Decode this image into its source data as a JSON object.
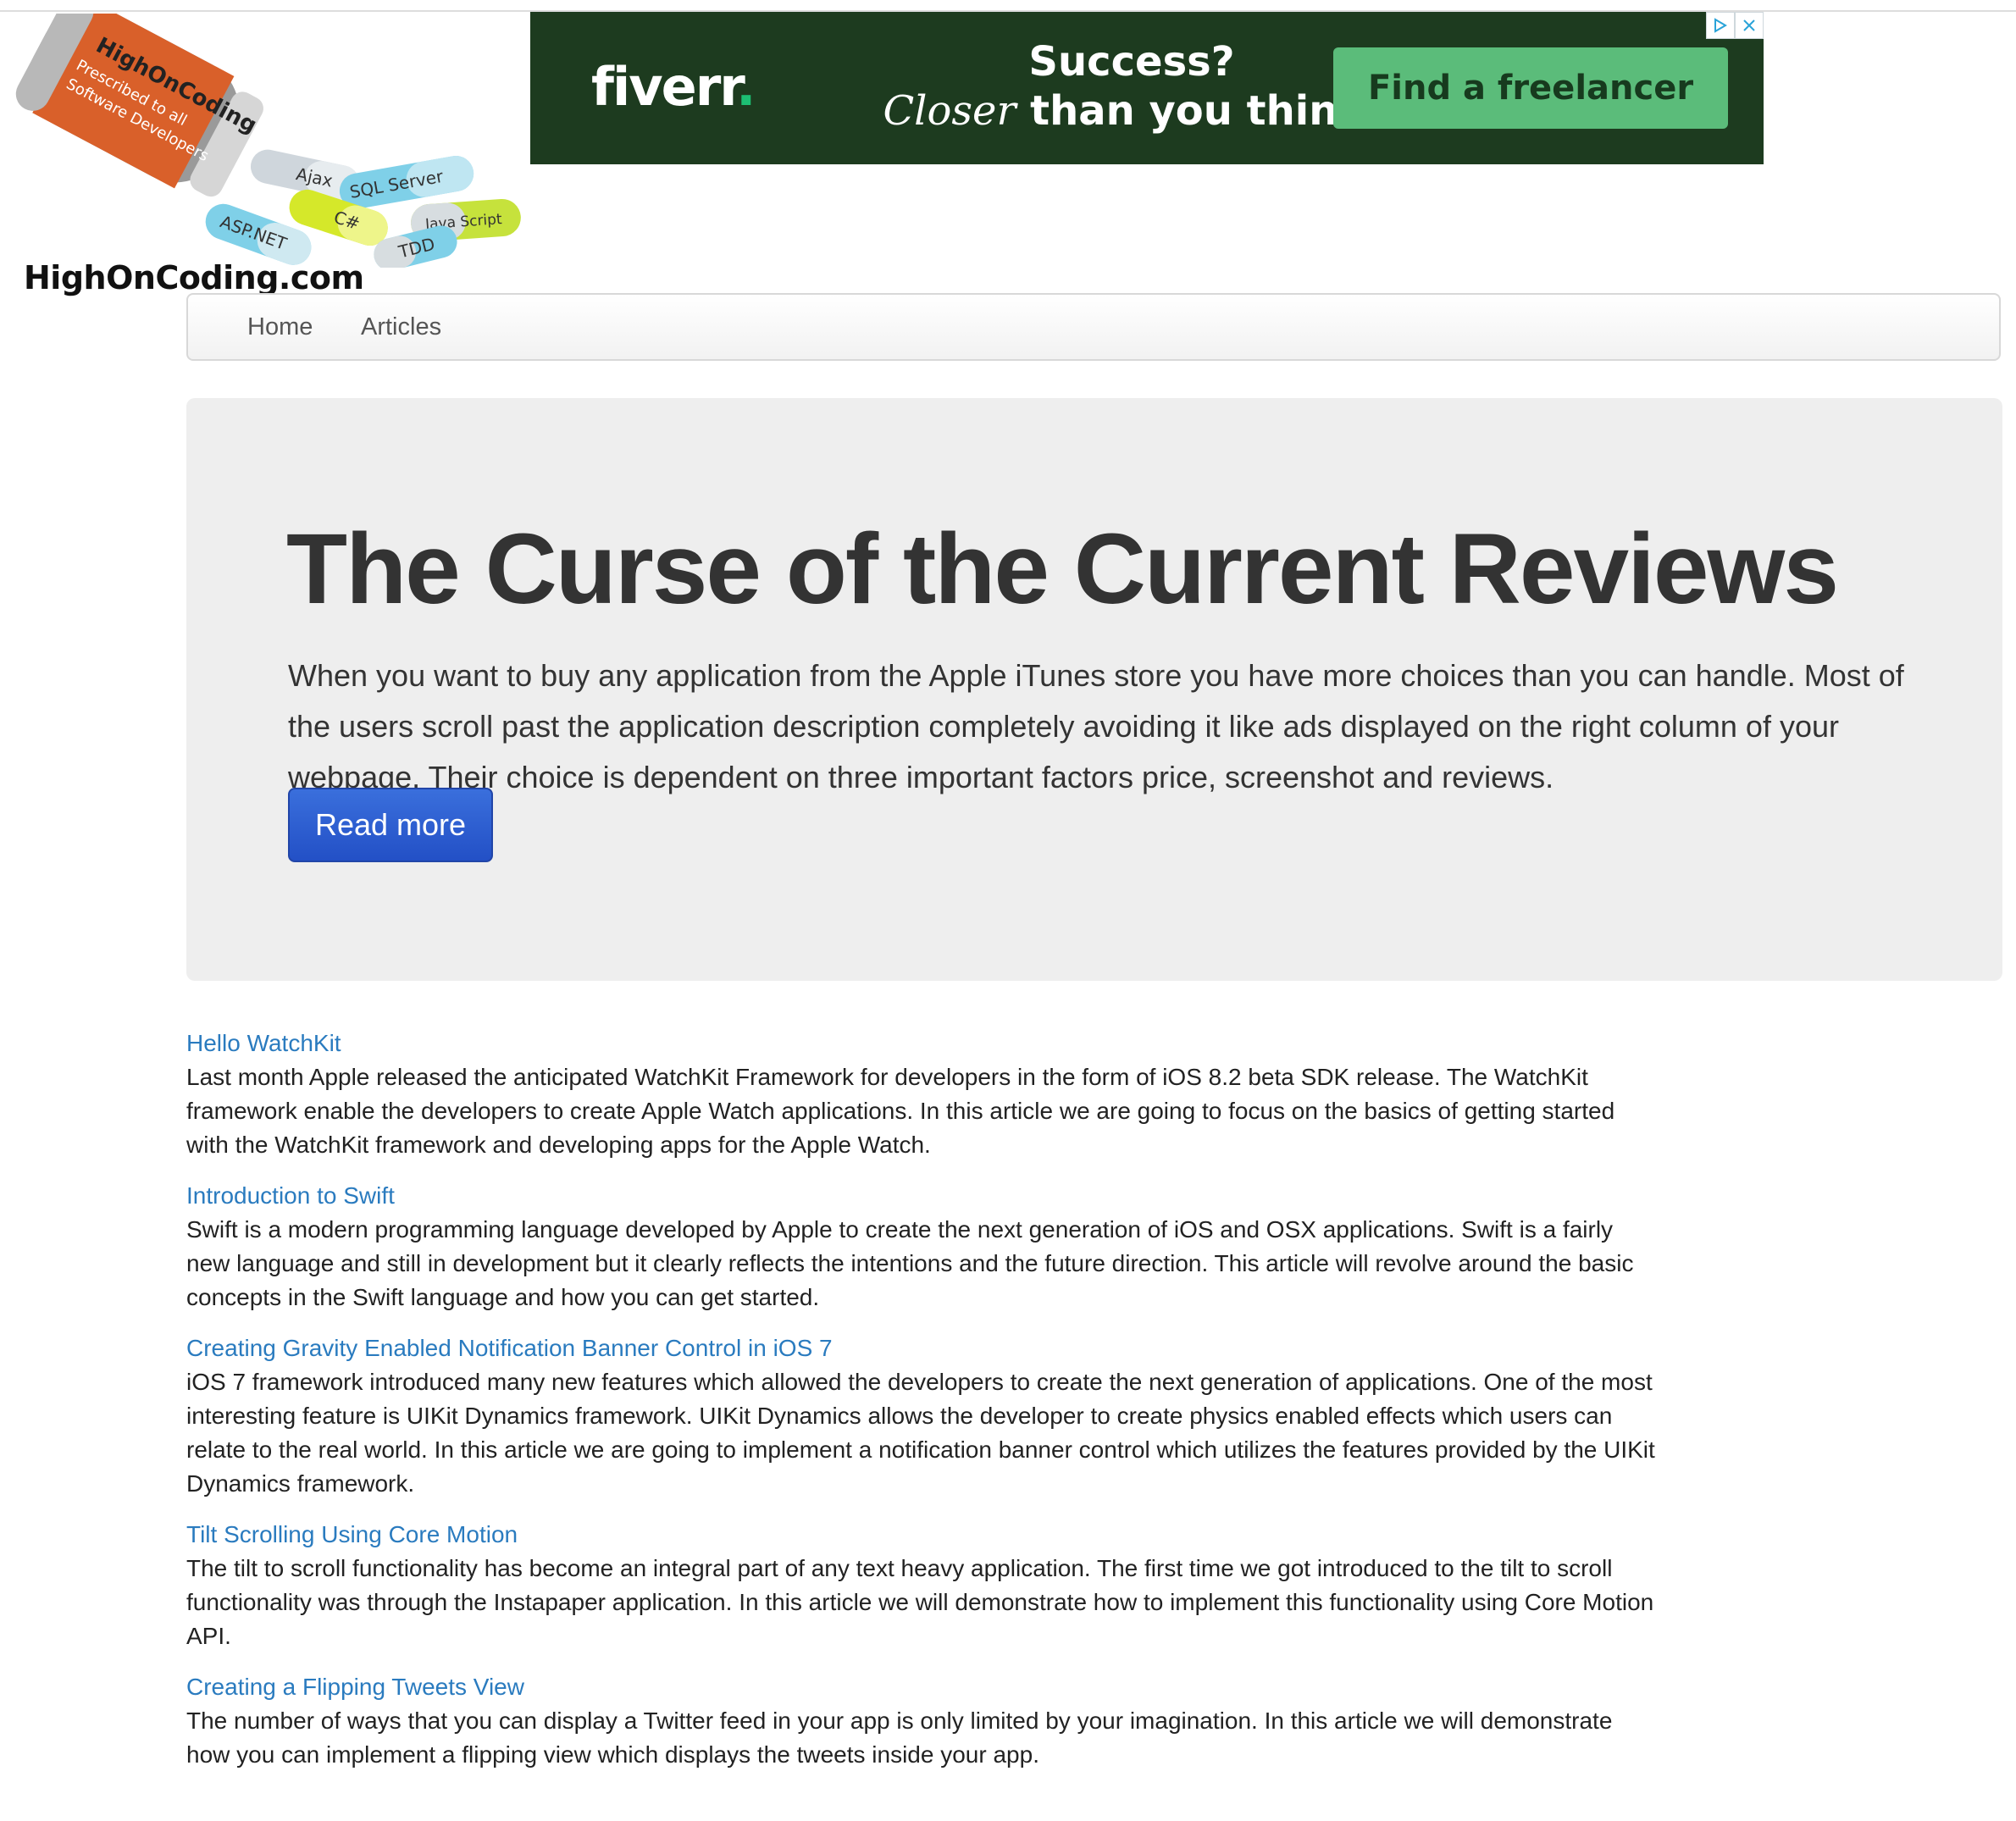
{
  "site": {
    "logo_text": "HighOnCoding.com",
    "logo_pill_labels": [
      "Ajax",
      "SQL Server",
      "C#",
      "Java Script",
      "ASP.NET",
      "TDD"
    ],
    "logo_bottle_text": "HighOnCoding Prescribed to all Software Developers"
  },
  "ad": {
    "brand": "fiverr",
    "brand_dot": ".",
    "headline_line1": "Success?",
    "headline_italic": "Closer",
    "headline_line2_rest": "than you think.",
    "cta_label": "Find a freelancer",
    "adchoices_icon": "adchoices-icon",
    "close_icon": "close-icon",
    "background_color": "#1d3b1f",
    "cta_color": "#5bbc7a"
  },
  "nav": {
    "items": [
      {
        "label": "Home"
      },
      {
        "label": "Articles"
      }
    ]
  },
  "jumbotron": {
    "title": "The Curse of the Current Reviews",
    "lead": "When you want to buy any application from the Apple iTunes store you have more choices than you can handle. Most of the users scroll past the application description completely avoiding it like ads displayed on the right column of your webpage. Their choice is dependent on three important factors price, screenshot and reviews.",
    "button_label": "Read more",
    "button_color": "#2a5bd7"
  },
  "articles": [
    {
      "title": "Hello WatchKit",
      "description": "Last month Apple released the anticipated WatchKit Framework for developers in the form of iOS 8.2 beta SDK release. The WatchKit framework enable the developers to create Apple Watch applications. In this article we are going to focus on the basics of getting started with the WatchKit framework and developing apps for the Apple Watch."
    },
    {
      "title": "Introduction to Swift",
      "description": "Swift is a modern programming language developed by Apple to create the next generation of iOS and OSX applications. Swift is a fairly new language and still in development but it clearly reflects the intentions and the future direction. This article will revolve around the basic concepts in the Swift language and how you can get started."
    },
    {
      "title": "Creating Gravity Enabled Notification Banner Control in iOS 7",
      "description": "iOS 7 framework introduced many new features which allowed the developers to create the next generation of applications. One of the most interesting feature is UIKit Dynamics framework. UIKit Dynamics allows the developer to create physics enabled effects which users can relate to the real world. In this article we are going to implement a notification banner control which utilizes the features provided by the UIKit Dynamics framework."
    },
    {
      "title": "Tilt Scrolling Using Core Motion",
      "description": "The tilt to scroll functionality has become an integral part of any text heavy application. The first time we got introduced to the tilt to scroll functionality was through the Instapaper application. In this article we will demonstrate how to implement this functionality using Core Motion API."
    },
    {
      "title": "Creating a Flipping Tweets View",
      "description": "The number of ways that you can display a Twitter feed in your app is only limited by your imagination. In this article we will demonstrate how you can implement a flipping view which displays the tweets inside your app."
    }
  ],
  "colors": {
    "link": "#2a7bbf",
    "jumbotron_bg": "#eeeeee",
    "title_text": "#333333"
  }
}
